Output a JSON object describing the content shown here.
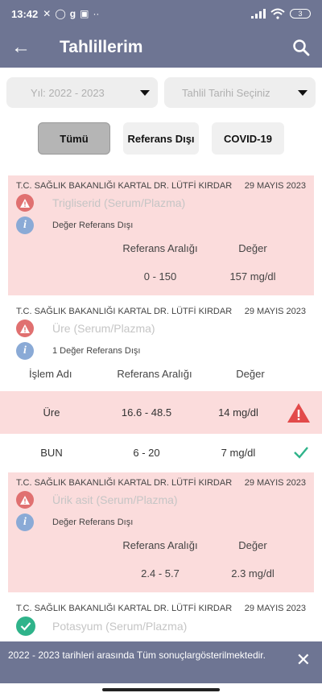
{
  "status": {
    "time": "13:42",
    "battery": "3"
  },
  "appbar": {
    "title": "Tahlillerim"
  },
  "filters": {
    "year": "Yıl: 2022 - 2023",
    "date": "Tahlil Tarihi Seçiniz"
  },
  "tabs": [
    {
      "label": "Tümü"
    },
    {
      "label": "Referans Dışı"
    },
    {
      "label": "COVID-19"
    }
  ],
  "cards": [
    {
      "hospital": "T.C. SAĞLIK BAKANLIĞI KARTAL DR. LÜTFİ KIRDAR",
      "date": "29 MAYIS 2023",
      "test": "Trigliserid (Serum/Plazma)",
      "note": "Değer Referans Dışı",
      "col_range": "Referans Aralığı",
      "col_value": "Değer",
      "range": "0 - 150",
      "value": "157 mg/dl"
    },
    {
      "hospital": "T.C. SAĞLIK BAKANLIĞI KARTAL DR. LÜTFİ KIRDAR",
      "date": "29 MAYIS 2023",
      "test": "Üre (Serum/Plazma)",
      "note": "1 Değer Referans Dışı",
      "col_name": "İşlem Adı",
      "col_range": "Referans Aralığı",
      "col_value": "Değer",
      "rows": [
        {
          "name": "Üre",
          "range": "16.6 - 48.5",
          "value": "14 mg/dl"
        },
        {
          "name": "BUN",
          "range": "6 - 20",
          "value": "7 mg/dl"
        }
      ]
    },
    {
      "hospital": "T.C. SAĞLIK BAKANLIĞI KARTAL DR. LÜTFİ KIRDAR",
      "date": "29 MAYIS 2023",
      "test": "Ürik asit (Serum/Plazma)",
      "note": "Değer Referans Dışı",
      "col_range": "Referans Aralığı",
      "col_value": "Değer",
      "range": "2.4 - 5.7",
      "value": "2.3 mg/dl"
    },
    {
      "hospital": "T.C. SAĞLIK BAKANLIĞI KARTAL DR. LÜTFİ KIRDAR",
      "date": "29 MAYIS 2023",
      "test": "Potasyum (Serum/Plazma)"
    }
  ],
  "snackbar": {
    "message": "2022 - 2023 tarihleri arasında Tüm sonuçlargösterilmektedir."
  }
}
